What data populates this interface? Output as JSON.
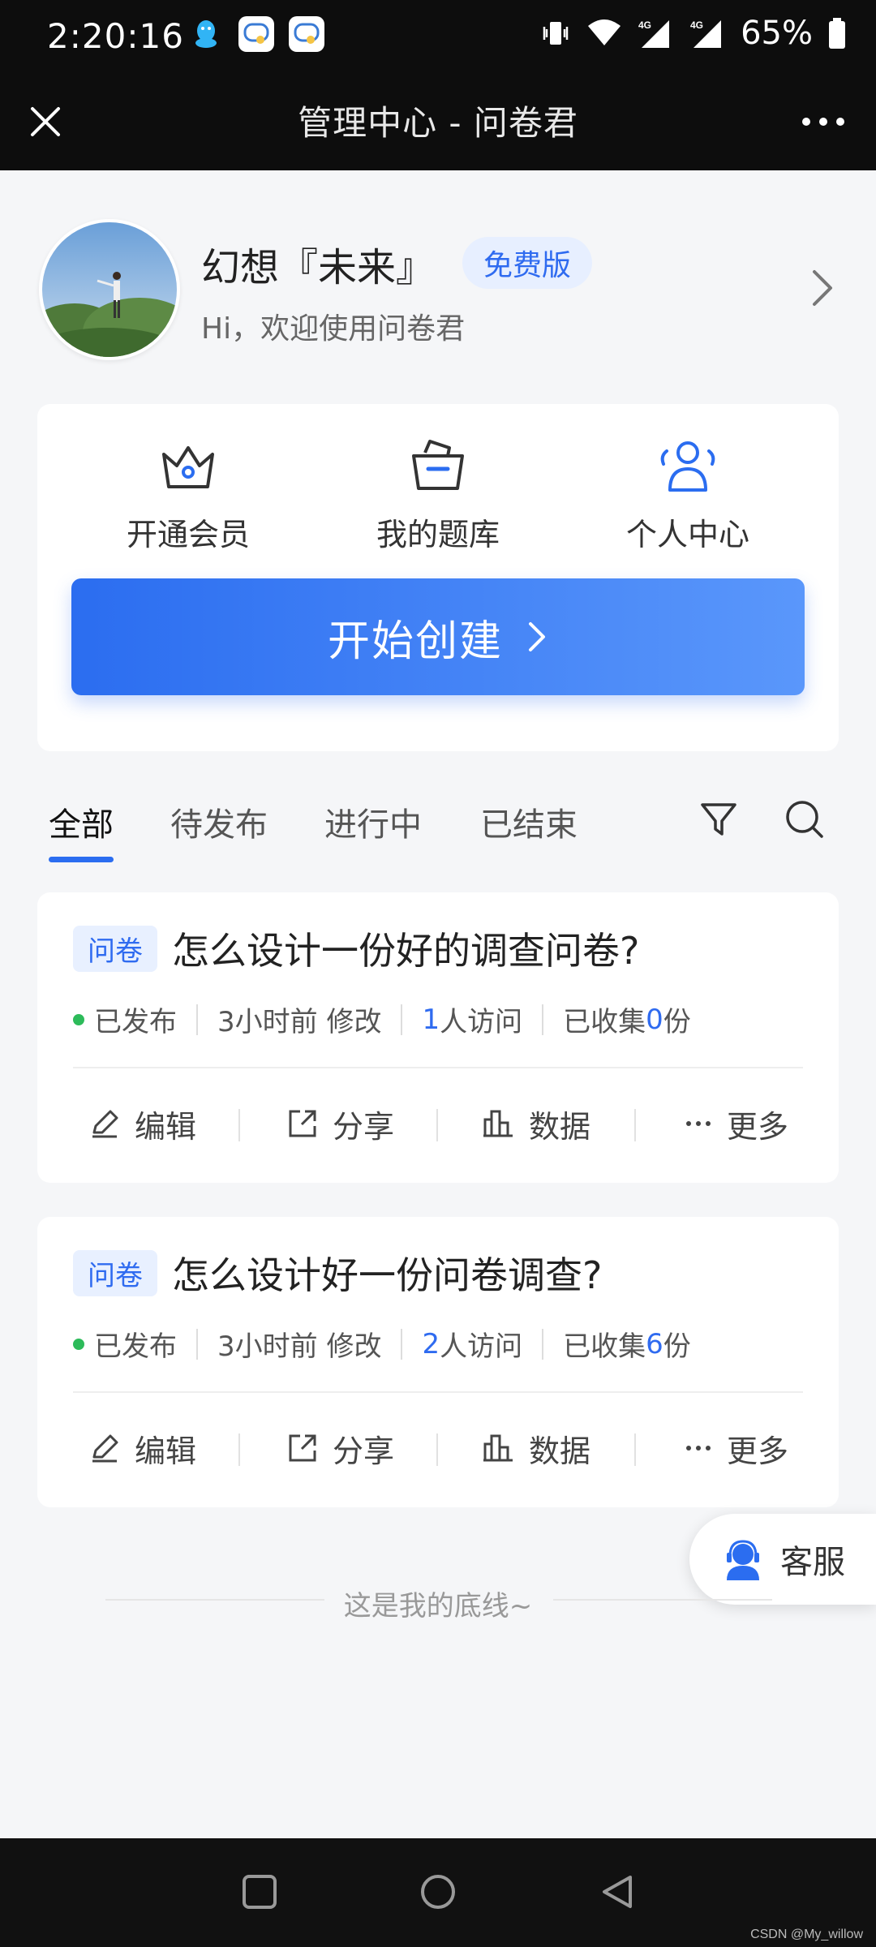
{
  "status_bar": {
    "time": "2:20:16",
    "battery": "65%",
    "apps": [
      "qq-icon",
      "chat-bubble-icon",
      "chat-bubble-icon"
    ]
  },
  "header": {
    "title": "管理中心 - 问卷君"
  },
  "profile": {
    "name": "幻想『未来』",
    "badge": "免费版",
    "greeting": "Hi，欢迎使用问卷君"
  },
  "quick_actions": [
    {
      "label": "开通会员",
      "icon": "crown-icon"
    },
    {
      "label": "我的题库",
      "icon": "basket-icon"
    },
    {
      "label": "个人中心",
      "icon": "user-group-icon"
    }
  ],
  "create_button": {
    "label": "开始创建"
  },
  "tabs": [
    {
      "label": "全部",
      "active": true
    },
    {
      "label": "待发布",
      "active": false
    },
    {
      "label": "进行中",
      "active": false
    },
    {
      "label": "已结束",
      "active": false
    }
  ],
  "surveys": [
    {
      "type": "问卷",
      "title": "怎么设计一份好的调查问卷?",
      "status": "已发布",
      "modified": "3小时前 修改",
      "visits_num": "1",
      "visits_suffix": "人访问",
      "collected_prefix": "已收集",
      "collected_num": "0",
      "collected_suffix": "份"
    },
    {
      "type": "问卷",
      "title": "怎么设计好一份问卷调查?",
      "status": "已发布",
      "modified": "3小时前 修改",
      "visits_num": "2",
      "visits_suffix": "人访问",
      "collected_prefix": "已收集",
      "collected_num": "6",
      "collected_suffix": "份"
    }
  ],
  "card_actions": {
    "edit": "编辑",
    "share": "分享",
    "data": "数据",
    "more": "更多"
  },
  "service": {
    "label": "客服"
  },
  "footer": {
    "text": "这是我的底线~"
  },
  "watermark": "CSDN @My_willow",
  "colors": {
    "accent": "#2b6df0",
    "published": "#2dbb5a",
    "header_bg": "#0d0d0d"
  }
}
